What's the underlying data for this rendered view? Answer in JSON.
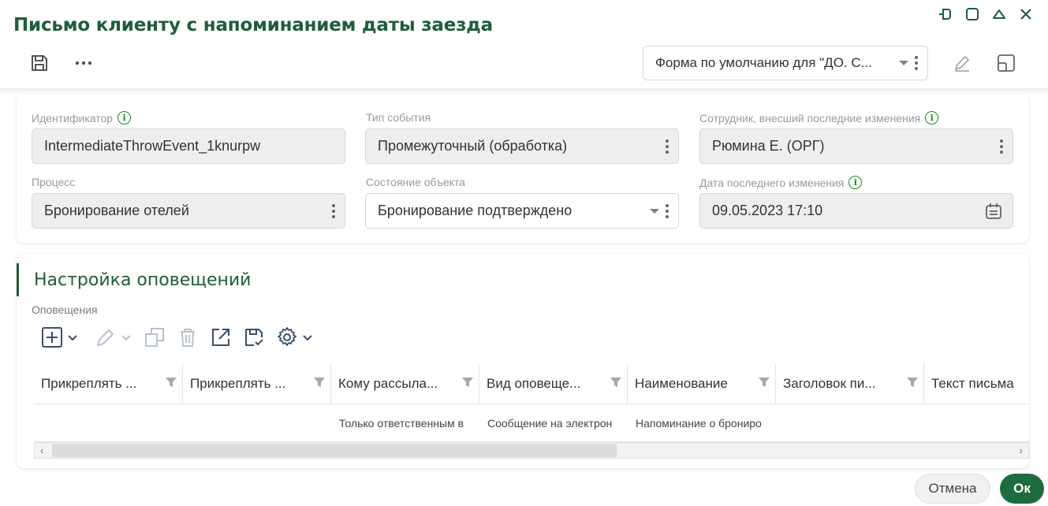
{
  "window": {
    "title": "Письмо клиенту с напоминанием даты заезда",
    "controls": [
      "pin-icon",
      "maximize-icon",
      "collapse-icon",
      "close-icon"
    ]
  },
  "toolbar": {
    "icons": [
      "save-icon",
      "more-icon"
    ],
    "form_select": "Форма по умолчанию для \"ДО. С...",
    "right_icons": [
      "edit-form-icon",
      "layout-icon"
    ]
  },
  "fields": {
    "identifier": {
      "label": "Идентификатор",
      "value": "IntermediateThrowEvent_1knurpw"
    },
    "event_type": {
      "label": "Тип события",
      "value": "Промежуточный (обработка)"
    },
    "employee": {
      "label": "Сотрудник, внесший последние изменения",
      "value": "Рюмина Е. (ОРГ)"
    },
    "process": {
      "label": "Процесс",
      "value": "Бронирование отелей"
    },
    "object_state": {
      "label": "Состояние объекта",
      "value": "Бронирование подтверждено"
    },
    "last_modified": {
      "label": "Дата последнего изменения",
      "value": "09.05.2023 17:10"
    }
  },
  "notifications": {
    "section_title": "Настройка оповещений",
    "table_label": "Оповещения",
    "toolbar_icons": [
      "add-icon",
      "edit-icon",
      "copy-icon",
      "delete-icon",
      "open-icon",
      "save-template-icon",
      "settings-icon"
    ],
    "columns": [
      "Прикреплять ...",
      "Прикреплять ...",
      "Кому рассыла...",
      "Вид оповеще...",
      "Наименование",
      "Заголовок пи...",
      "Текст письма"
    ],
    "rows": [
      [
        "",
        "",
        "Только ответственным в",
        "Сообщение на электрон",
        "Напоминание о брониро",
        "",
        ""
      ]
    ]
  },
  "footer": {
    "cancel": "Отмена",
    "ok": "Ок"
  },
  "colors": {
    "accent": "#1f5d3a",
    "ok_button": "#1f6b40",
    "info_icon": "#1a8a1a"
  }
}
